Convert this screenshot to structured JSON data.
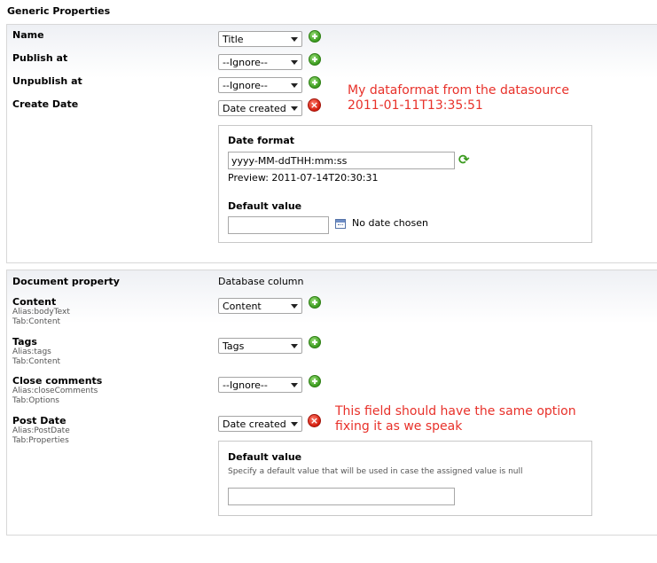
{
  "section_title": "Generic Properties",
  "generic": {
    "rows": [
      {
        "label": "Name",
        "select": "Title"
      },
      {
        "label": "Publish at",
        "select": "--Ignore--"
      },
      {
        "label": "Unpublish at",
        "select": "--Ignore--"
      },
      {
        "label": "Create Date",
        "select": "Date created"
      }
    ],
    "note_line1": "My dataformat from the datasource",
    "note_line2": "2011-01-11T13:35:51",
    "date_format": {
      "title": "Date format",
      "value": "yyyy-MM-ddTHH:mm:ss",
      "preview": "Preview: 2011-07-14T20:30:31",
      "default_title": "Default value",
      "default_value": "",
      "no_date": "No date chosen"
    }
  },
  "document": {
    "col1": "Document property",
    "col2": "Database column",
    "rows": [
      {
        "label": "Content",
        "alias": "Alias:bodyText",
        "tab": "Tab:Content",
        "select": "Content"
      },
      {
        "label": "Tags",
        "alias": "Alias:tags",
        "tab": "Tab:Content",
        "select": "Tags"
      },
      {
        "label": "Close comments",
        "alias": "Alias:closeComments",
        "tab": "Tab:Options",
        "select": "--Ignore--"
      },
      {
        "label": "Post Date",
        "alias": "Alias:PostDate",
        "tab": "Tab:Properties",
        "select": "Date created"
      }
    ],
    "note_line1": "This field should have the same option",
    "note_line2": "fixing it as we speak",
    "default_box": {
      "title": "Default value",
      "desc": "Specify a default value that will be used in case the assigned value is null",
      "value": ""
    }
  },
  "icons": {
    "add": "add-icon",
    "remove": "remove-icon",
    "refresh": "refresh-icon",
    "calendar": "calendar-icon"
  },
  "colors": {
    "note": "#e8312a",
    "add": "#3a9a1e",
    "remove": "#d31c0c"
  }
}
